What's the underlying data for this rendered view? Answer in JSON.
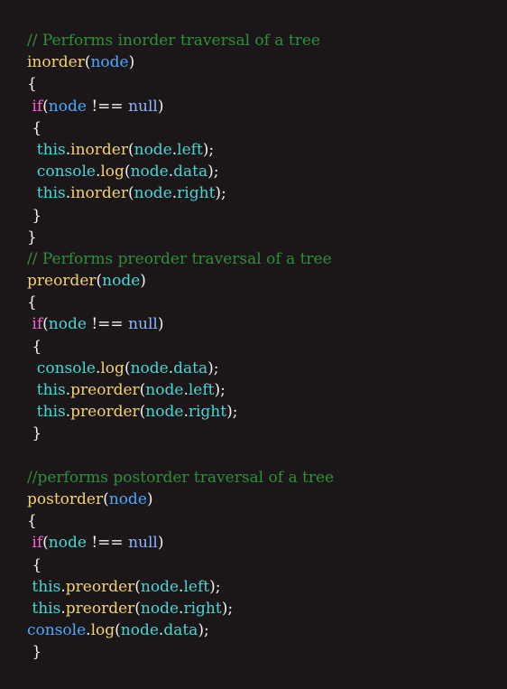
{
  "code": {
    "lines": [
      {
        "tokens": [
          {
            "t": "// Performs inorder traversal of a tree",
            "c": "comment"
          }
        ]
      },
      {
        "tokens": [
          {
            "t": "inorder",
            "c": "func"
          },
          {
            "t": "(",
            "c": "punct"
          },
          {
            "t": "node",
            "c": "param"
          },
          {
            "t": ")",
            "c": "punct"
          }
        ]
      },
      {
        "tokens": [
          {
            "t": "{",
            "c": "punct"
          }
        ]
      },
      {
        "tokens": [
          {
            "t": " if",
            "c": "keyword"
          },
          {
            "t": "(",
            "c": "punct"
          },
          {
            "t": "node",
            "c": "param"
          },
          {
            "t": " !== ",
            "c": "punct"
          },
          {
            "t": "null",
            "c": "null"
          },
          {
            "t": ")",
            "c": "punct"
          }
        ]
      },
      {
        "tokens": [
          {
            "t": " {",
            "c": "punct"
          }
        ]
      },
      {
        "tokens": [
          {
            "t": "  this",
            "c": "ident"
          },
          {
            "t": ".",
            "c": "punct"
          },
          {
            "t": "inorder",
            "c": "func"
          },
          {
            "t": "(",
            "c": "punct"
          },
          {
            "t": "node",
            "c": "ident"
          },
          {
            "t": ".",
            "c": "punct"
          },
          {
            "t": "left",
            "c": "ident"
          },
          {
            "t": ");",
            "c": "punct"
          }
        ]
      },
      {
        "tokens": [
          {
            "t": "  console",
            "c": "ident"
          },
          {
            "t": ".",
            "c": "punct"
          },
          {
            "t": "log",
            "c": "func"
          },
          {
            "t": "(",
            "c": "punct"
          },
          {
            "t": "node",
            "c": "ident"
          },
          {
            "t": ".",
            "c": "punct"
          },
          {
            "t": "data",
            "c": "ident"
          },
          {
            "t": ");",
            "c": "punct"
          }
        ]
      },
      {
        "tokens": [
          {
            "t": "  this",
            "c": "ident"
          },
          {
            "t": ".",
            "c": "punct"
          },
          {
            "t": "inorder",
            "c": "func"
          },
          {
            "t": "(",
            "c": "punct"
          },
          {
            "t": "node",
            "c": "ident"
          },
          {
            "t": ".",
            "c": "punct"
          },
          {
            "t": "right",
            "c": "ident"
          },
          {
            "t": ");",
            "c": "punct"
          }
        ]
      },
      {
        "tokens": [
          {
            "t": " }",
            "c": "punct"
          }
        ]
      },
      {
        "tokens": [
          {
            "t": "}",
            "c": "punct"
          }
        ]
      },
      {
        "tokens": [
          {
            "t": "// Performs preorder traversal of a tree",
            "c": "comment"
          }
        ]
      },
      {
        "tokens": [
          {
            "t": "preorder",
            "c": "func"
          },
          {
            "t": "(",
            "c": "punct"
          },
          {
            "t": "node",
            "c": "ident"
          },
          {
            "t": ")",
            "c": "punct"
          }
        ]
      },
      {
        "tokens": [
          {
            "t": "{",
            "c": "punct"
          }
        ]
      },
      {
        "tokens": [
          {
            "t": " if",
            "c": "keyword"
          },
          {
            "t": "(",
            "c": "punct"
          },
          {
            "t": "node",
            "c": "ident"
          },
          {
            "t": " !== ",
            "c": "punct"
          },
          {
            "t": "null",
            "c": "null"
          },
          {
            "t": ")",
            "c": "punct"
          }
        ]
      },
      {
        "tokens": [
          {
            "t": " {",
            "c": "punct"
          }
        ]
      },
      {
        "tokens": [
          {
            "t": "  console",
            "c": "ident"
          },
          {
            "t": ".",
            "c": "punct"
          },
          {
            "t": "log",
            "c": "func"
          },
          {
            "t": "(",
            "c": "punct"
          },
          {
            "t": "node",
            "c": "ident"
          },
          {
            "t": ".",
            "c": "punct"
          },
          {
            "t": "data",
            "c": "ident"
          },
          {
            "t": ");",
            "c": "punct"
          }
        ]
      },
      {
        "tokens": [
          {
            "t": "  this",
            "c": "ident"
          },
          {
            "t": ".",
            "c": "punct"
          },
          {
            "t": "preorder",
            "c": "func"
          },
          {
            "t": "(",
            "c": "punct"
          },
          {
            "t": "node",
            "c": "ident"
          },
          {
            "t": ".",
            "c": "punct"
          },
          {
            "t": "left",
            "c": "ident"
          },
          {
            "t": ");",
            "c": "punct"
          }
        ]
      },
      {
        "tokens": [
          {
            "t": "  this",
            "c": "ident"
          },
          {
            "t": ".",
            "c": "punct"
          },
          {
            "t": "preorder",
            "c": "func"
          },
          {
            "t": "(",
            "c": "punct"
          },
          {
            "t": "node",
            "c": "ident"
          },
          {
            "t": ".",
            "c": "punct"
          },
          {
            "t": "right",
            "c": "ident"
          },
          {
            "t": ");",
            "c": "punct"
          }
        ]
      },
      {
        "tokens": [
          {
            "t": " }",
            "c": "punct"
          }
        ]
      },
      {
        "tokens": []
      },
      {
        "tokens": [
          {
            "t": "//performs postorder traversal of a tree",
            "c": "comment"
          }
        ]
      },
      {
        "tokens": [
          {
            "t": "postorder",
            "c": "func"
          },
          {
            "t": "(",
            "c": "punct"
          },
          {
            "t": "node",
            "c": "param"
          },
          {
            "t": ")",
            "c": "punct"
          }
        ]
      },
      {
        "tokens": [
          {
            "t": "{",
            "c": "punct"
          }
        ]
      },
      {
        "tokens": [
          {
            "t": " if",
            "c": "keyword"
          },
          {
            "t": "(",
            "c": "punct"
          },
          {
            "t": "node",
            "c": "ident"
          },
          {
            "t": " !== ",
            "c": "punct"
          },
          {
            "t": "null",
            "c": "null"
          },
          {
            "t": ")",
            "c": "punct"
          }
        ]
      },
      {
        "tokens": [
          {
            "t": " {",
            "c": "punct"
          }
        ]
      },
      {
        "tokens": [
          {
            "t": " this",
            "c": "ident"
          },
          {
            "t": ".",
            "c": "punct"
          },
          {
            "t": "preorder",
            "c": "func"
          },
          {
            "t": "(",
            "c": "punct"
          },
          {
            "t": "node",
            "c": "ident"
          },
          {
            "t": ".",
            "c": "punct"
          },
          {
            "t": "left",
            "c": "ident"
          },
          {
            "t": ");",
            "c": "punct"
          }
        ]
      },
      {
        "tokens": [
          {
            "t": " this",
            "c": "ident"
          },
          {
            "t": ".",
            "c": "punct"
          },
          {
            "t": "preorder",
            "c": "func"
          },
          {
            "t": "(",
            "c": "punct"
          },
          {
            "t": "node",
            "c": "ident"
          },
          {
            "t": ".",
            "c": "punct"
          },
          {
            "t": "right",
            "c": "ident"
          },
          {
            "t": ");",
            "c": "punct"
          }
        ]
      },
      {
        "tokens": [
          {
            "t": "console",
            "c": "param"
          },
          {
            "t": ".",
            "c": "punct"
          },
          {
            "t": "log",
            "c": "func"
          },
          {
            "t": "(",
            "c": "punct"
          },
          {
            "t": "node",
            "c": "ident"
          },
          {
            "t": ".",
            "c": "punct"
          },
          {
            "t": "data",
            "c": "ident"
          },
          {
            "t": ");",
            "c": "punct"
          }
        ]
      },
      {
        "tokens": [
          {
            "t": " }",
            "c": "punct"
          }
        ]
      }
    ]
  }
}
